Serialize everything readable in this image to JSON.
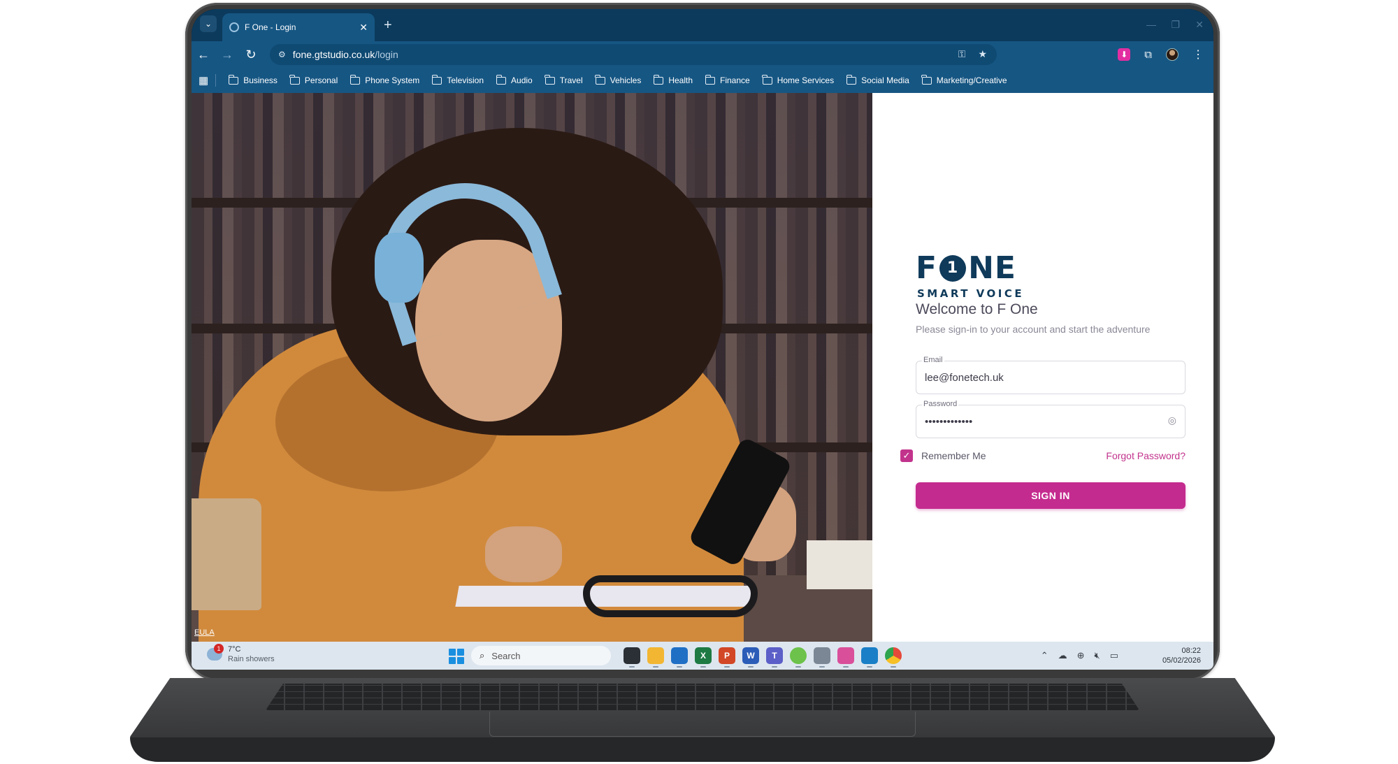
{
  "browser": {
    "tab_title": "F One - Login",
    "new_tab_symbol": "+",
    "url_domain": "fone.gtstudio.co.uk",
    "url_path": "/login",
    "bookmarks": [
      "Business",
      "Personal",
      "Phone System",
      "Television",
      "Audio",
      "Travel",
      "Vehicles",
      "Health",
      "Finance",
      "Home Services",
      "Social Media",
      "Marketing/Creative"
    ]
  },
  "page": {
    "eula_link": "EULA",
    "logo": {
      "main_left": "F",
      "main_digit": "1",
      "main_right": "NE",
      "sub": "SMART VOICE"
    },
    "welcome": "Welcome to F One",
    "tagline": "Please sign-in to your account and start the adventure",
    "email": {
      "label": "Email",
      "value": "lee@fonetech.uk"
    },
    "password": {
      "label": "Password",
      "value": "•••••••••••••"
    },
    "remember_me": {
      "label": "Remember Me",
      "checked": true
    },
    "forgot_password": "Forgot Password?",
    "sign_in": "SIGN IN"
  },
  "taskbar": {
    "weather": {
      "temp": "7°C",
      "desc": "Rain showers",
      "badge": "1"
    },
    "search_placeholder": "Search",
    "apps": [
      {
        "name": "task-view",
        "label": "",
        "color": "#2b2f36"
      },
      {
        "name": "file-explorer",
        "label": "",
        "color": "#f2b632"
      },
      {
        "name": "outlook",
        "label": "",
        "color": "#1f6fc5"
      },
      {
        "name": "excel",
        "label": "X",
        "color": "#1d7a43"
      },
      {
        "name": "powerpoint",
        "label": "P",
        "color": "#d24726"
      },
      {
        "name": "word",
        "label": "W",
        "color": "#2b5db8"
      },
      {
        "name": "teams",
        "label": "T",
        "color": "#5b5fc7"
      },
      {
        "name": "cloud-app",
        "label": "",
        "color": "#6cc24a"
      },
      {
        "name": "calculator",
        "label": "",
        "color": "#7b8795"
      },
      {
        "name": "snipping-tool",
        "label": "",
        "color": "#d94f9a"
      },
      {
        "name": "phone-app",
        "label": "",
        "color": "#1a7fc6"
      },
      {
        "name": "chrome",
        "label": "",
        "color": "#e5493a"
      }
    ],
    "time": "08:22",
    "date": "05/02/2026"
  },
  "colors": {
    "brand_navy": "#0f3a5a",
    "accent_pink": "#c42b8f",
    "browser_blue": "#165683"
  }
}
